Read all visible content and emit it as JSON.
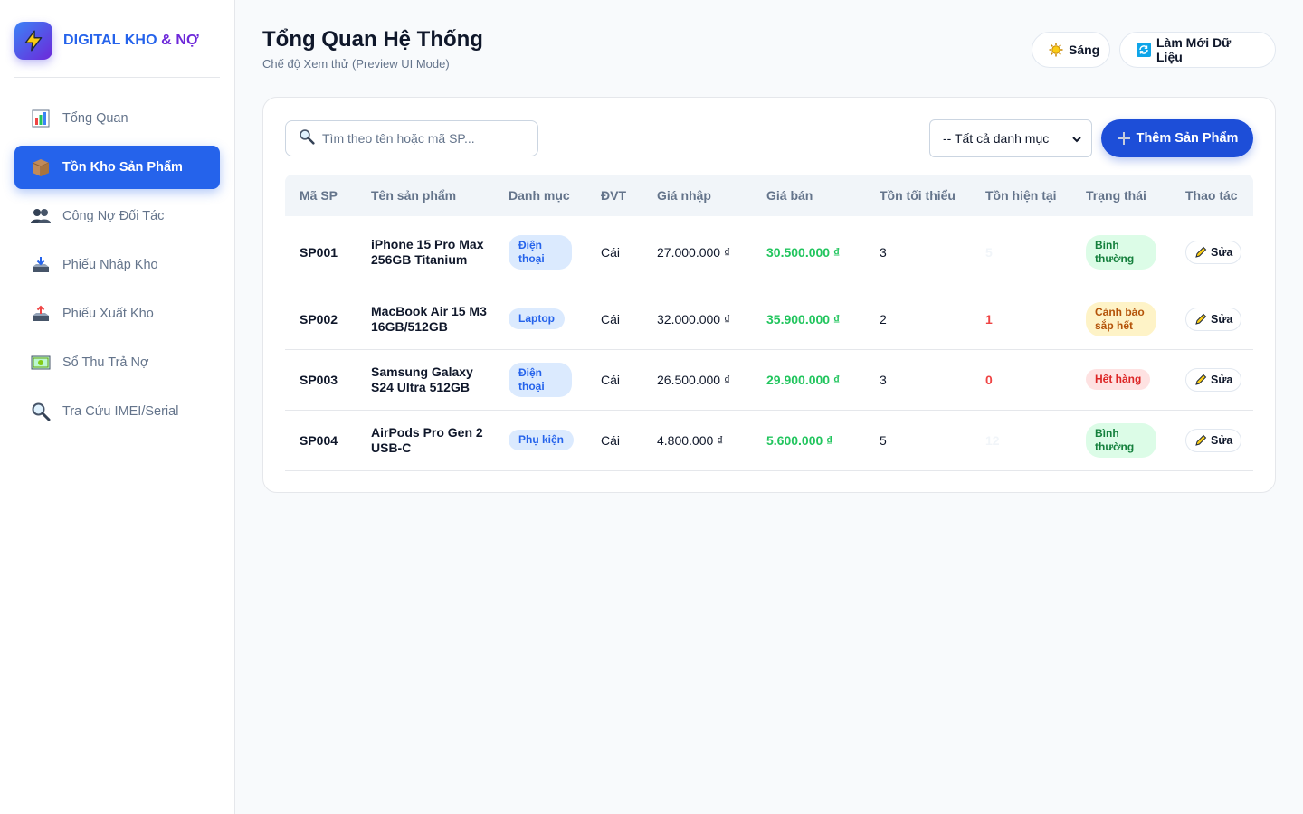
{
  "brand": {
    "name_part1": "DIGITAL KHO",
    "name_amp": " & NỢ"
  },
  "colors": {
    "accent": "#2563eb",
    "success": "#22c55e",
    "warning": "#b45309",
    "danger": "#ef4444"
  },
  "sidebar": {
    "items": [
      {
        "label": "Tổng Quan",
        "icon": "bar-chart-icon"
      },
      {
        "label": "Tồn Kho Sản Phẩm",
        "icon": "package-icon",
        "active": true
      },
      {
        "label": "Công Nợ Đối Tác",
        "icon": "users-icon"
      },
      {
        "label": "Phiếu Nhập Kho",
        "icon": "inbox-tray-icon"
      },
      {
        "label": "Phiếu Xuất Kho",
        "icon": "outbox-tray-icon"
      },
      {
        "label": "Sổ Thu Trả Nợ",
        "icon": "money-icon"
      },
      {
        "label": "Tra Cứu IMEI/Serial",
        "icon": "search-icon"
      }
    ]
  },
  "header": {
    "title": "Tổng Quan Hệ Thống",
    "subtitle": "Chế độ Xem thử (Preview UI Mode)",
    "theme_label": "Sáng",
    "refresh_label": "Làm Mới Dữ Liệu"
  },
  "toolbar": {
    "search_placeholder": "Tìm theo tên hoặc mã SP...",
    "category_selected": "-- Tất cả danh mục",
    "add_label": "Thêm Sản Phẩm"
  },
  "table": {
    "columns": [
      "Mã SP",
      "Tên sản phẩm",
      "Danh mục",
      "ĐVT",
      "Giá nhập",
      "Giá bán",
      "Tồn tối thiểu",
      "Tồn hiện tại",
      "Trạng thái",
      "Thao tác"
    ],
    "edit_label": "Sửa",
    "rows": [
      {
        "code": "SP001",
        "name": "iPhone 15 Pro Max 256GB Titanium",
        "category": "Điện thoại",
        "unit": "Cái",
        "cost": "27.000.000 ₫",
        "price": "30.500.000 ₫",
        "min_stock": "3",
        "current_stock": "5",
        "status": "Bình thường",
        "status_type": "ok"
      },
      {
        "code": "SP002",
        "name": "MacBook Air 15 M3 16GB/512GB",
        "category": "Laptop",
        "unit": "Cái",
        "cost": "32.000.000 ₫",
        "price": "35.900.000 ₫",
        "min_stock": "2",
        "current_stock": "1",
        "status": "Cảnh báo sắp hết",
        "status_type": "warn"
      },
      {
        "code": "SP003",
        "name": "Samsung Galaxy S24 Ultra 512GB",
        "category": "Điện thoại",
        "unit": "Cái",
        "cost": "26.500.000 ₫",
        "price": "29.900.000 ₫",
        "min_stock": "3",
        "current_stock": "0",
        "status": "Hết hàng",
        "status_type": "out"
      },
      {
        "code": "SP004",
        "name": "AirPods Pro Gen 2 USB-C",
        "category": "Phụ kiện",
        "unit": "Cái",
        "cost": "4.800.000 ₫",
        "price": "5.600.000 ₫",
        "min_stock": "5",
        "current_stock": "12",
        "status": "Bình thường",
        "status_type": "ok"
      }
    ]
  }
}
